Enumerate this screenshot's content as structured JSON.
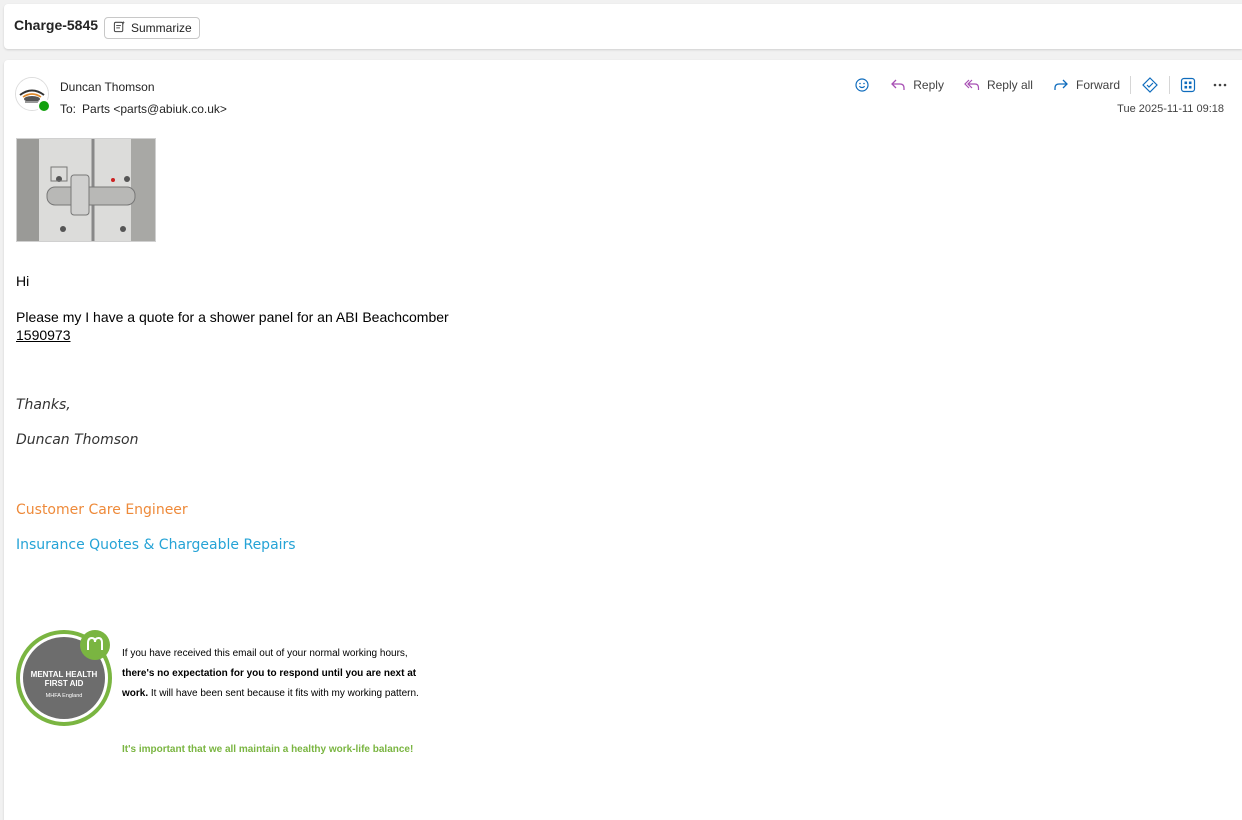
{
  "header": {
    "subject": "Charge-5845",
    "summarize_label": "Summarize"
  },
  "message": {
    "sender_name": "Duncan Thomson",
    "to_label": "To:",
    "to_value": "Parts <parts@abiuk.co.uk>",
    "date": "Tue 2025-11-11 09:18",
    "actions": {
      "reply": "Reply",
      "reply_all": "Reply all",
      "forward": "Forward"
    },
    "body": {
      "greeting": "Hi",
      "line1": "Please my I have a quote for a shower panel for an ABI Beachcomber",
      "line2": "1590973",
      "thanks": "Thanks,",
      "signature_name": "Duncan Thomson",
      "job_title": "Customer Care Engineer",
      "department": "Insurance Quotes & Chargeable Repairs"
    },
    "badge": {
      "line1": "MENTAL HEALTH",
      "line2": "FIRST AID",
      "line3": "MHFA England"
    },
    "notice": {
      "part1": "If you have received this email out of your normal working hours, ",
      "part2": "there's no expectation for you to respond until you are next at work.",
      "part3": " It will have been sent because it fits with my working pattern.",
      "green": "It's important that we all maintain a healthy work-life balance!"
    }
  },
  "colors": {
    "orange": "#ee8a3a",
    "blue": "#25a3d6",
    "green": "#7ab541",
    "presence": "#13a10e"
  }
}
